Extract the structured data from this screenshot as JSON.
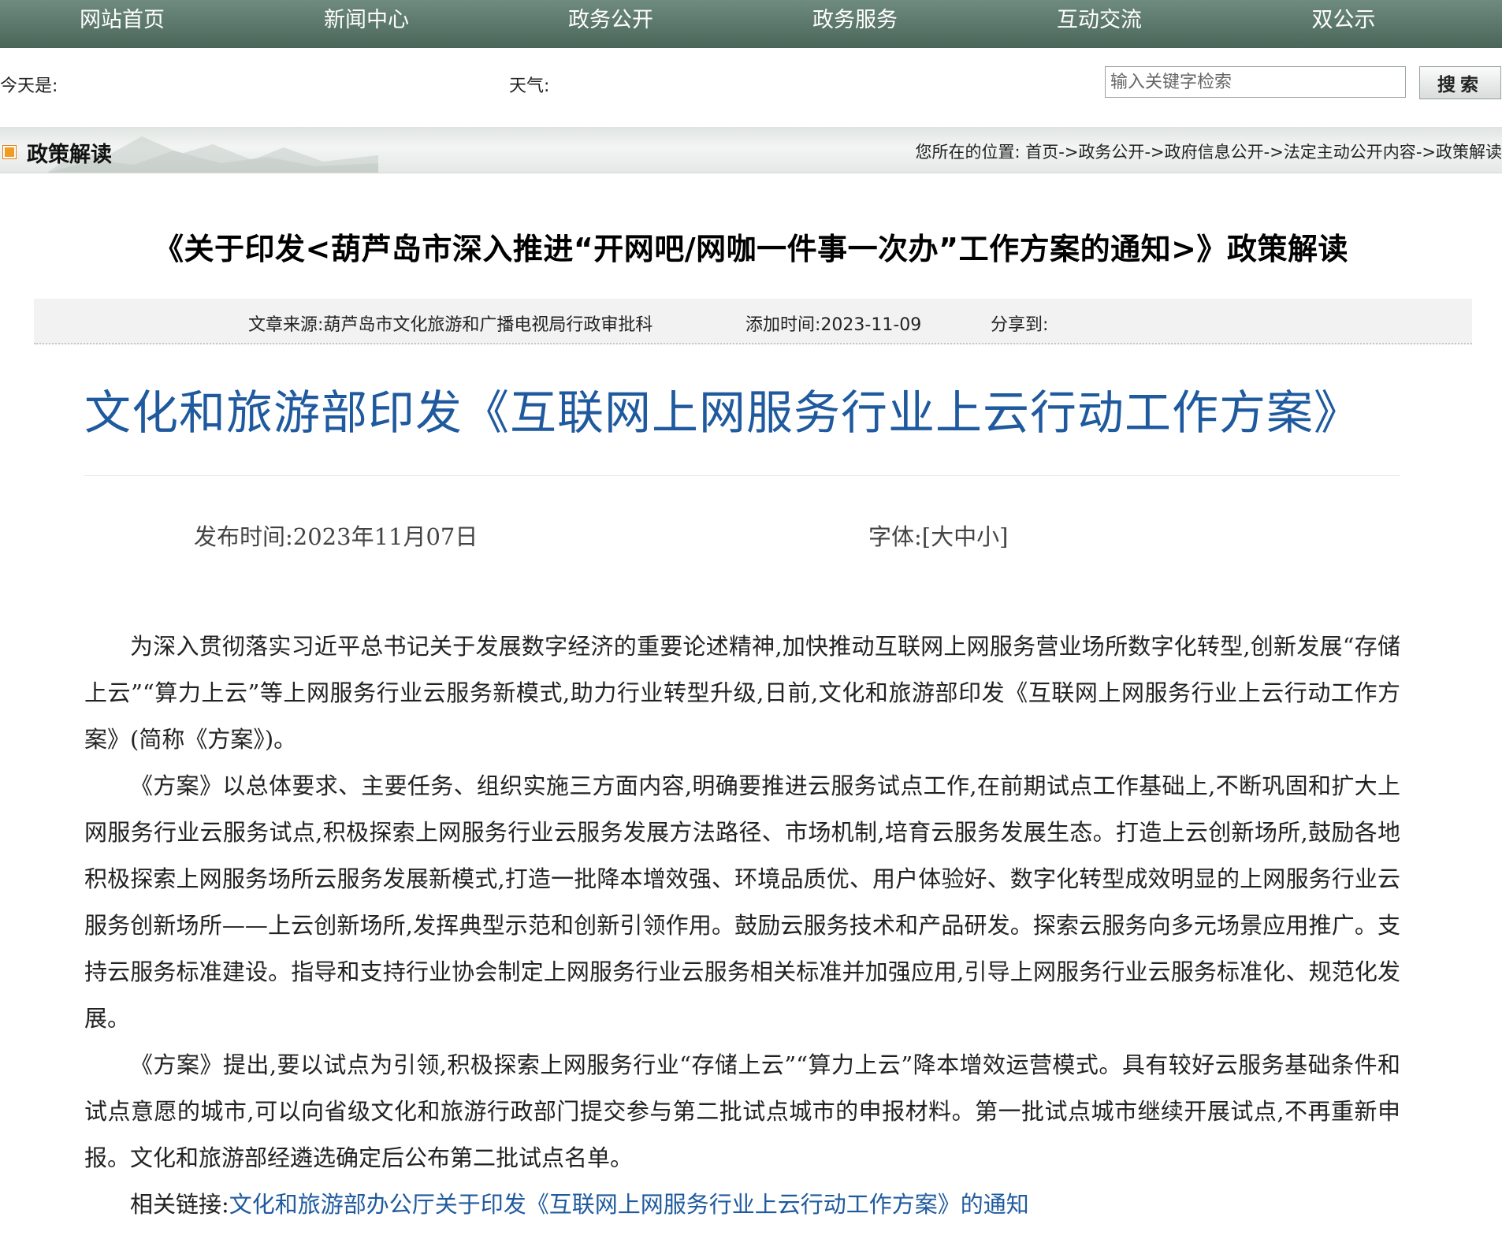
{
  "nav": {
    "items": [
      {
        "label": "网站首页"
      },
      {
        "label": "新闻中心"
      },
      {
        "label": "政务公开"
      },
      {
        "label": "政务服务"
      },
      {
        "label": "互动交流"
      },
      {
        "label": "双公示"
      }
    ]
  },
  "infobar": {
    "today_label": "今天是:",
    "weather_label": "天气:",
    "search_placeholder": "输入关键字检索",
    "search_button": "搜索"
  },
  "section": {
    "title": "政策解读",
    "breadcrumb_prefix": "您所在的位置:",
    "breadcrumb": [
      "首页",
      "政务公开",
      "政府信息公开",
      "法定主动公开内容",
      "政策解读"
    ],
    "separator": "->"
  },
  "headline": "《关于印发<葫芦岛市深入推进“开网吧/网咖一件事一次办”工作方案的通知>》政策解读",
  "meta": {
    "source": "文章来源:葫芦岛市文化旅游和广播电视局行政审批科",
    "added_time": "添加时间:2023-11-09",
    "share": "分享到:"
  },
  "article": {
    "title": "文化和旅游部印发《互联网上网服务行业上云行动工作方案》",
    "publish_time": "发布时间:2023年11月07日",
    "font_label": "字体:[",
    "font_large": "大",
    "font_medium": "中",
    "font_small": "小",
    "font_close": "]",
    "paragraphs": [
      "为深入贯彻落实习近平总书记关于发展数字经济的重要论述精神,加快推动互联网上网服务营业场所数字化转型,创新发展“存储上云”“算力上云”等上网服务行业云服务新模式,助力行业转型升级,日前,文化和旅游部印发《互联网上网服务行业上云行动工作方案》(简称《方案》)。",
      "《方案》以总体要求、主要任务、组织实施三方面内容,明确要推进云服务试点工作,在前期试点工作基础上,不断巩固和扩大上网服务行业云服务试点,积极探索上网服务行业云服务发展方法路径、市场机制,培育云服务发展生态。打造上云创新场所,鼓励各地积极探索上网服务场所云服务发展新模式,打造一批降本增效强、环境品质优、用户体验好、数字化转型成效明显的上网服务行业云服务创新场所——上云创新场所,发挥典型示范和创新引领作用。鼓励云服务技术和产品研发。探索云服务向多元场景应用推广。支持云服务标准建设。指导和支持行业协会制定上网服务行业云服务相关标准并加强应用,引导上网服务行业云服务标准化、规范化发展。",
      "《方案》提出,要以试点为引领,积极探索上网服务行业“存储上云”“算力上云”降本增效运营模式。具有较好云服务基础条件和试点意愿的城市,可以向省级文化和旅游行政部门提交参与第二批试点城市的申报材料。第一批试点城市继续开展试点,不再重新申报。文化和旅游部经遴选确定后公布第二批试点名单。"
    ],
    "related_label": "相关链接:",
    "related_link": "文化和旅游部办公厅关于印发《互联网上网服务行业上云行动工作方案》的通知"
  }
}
